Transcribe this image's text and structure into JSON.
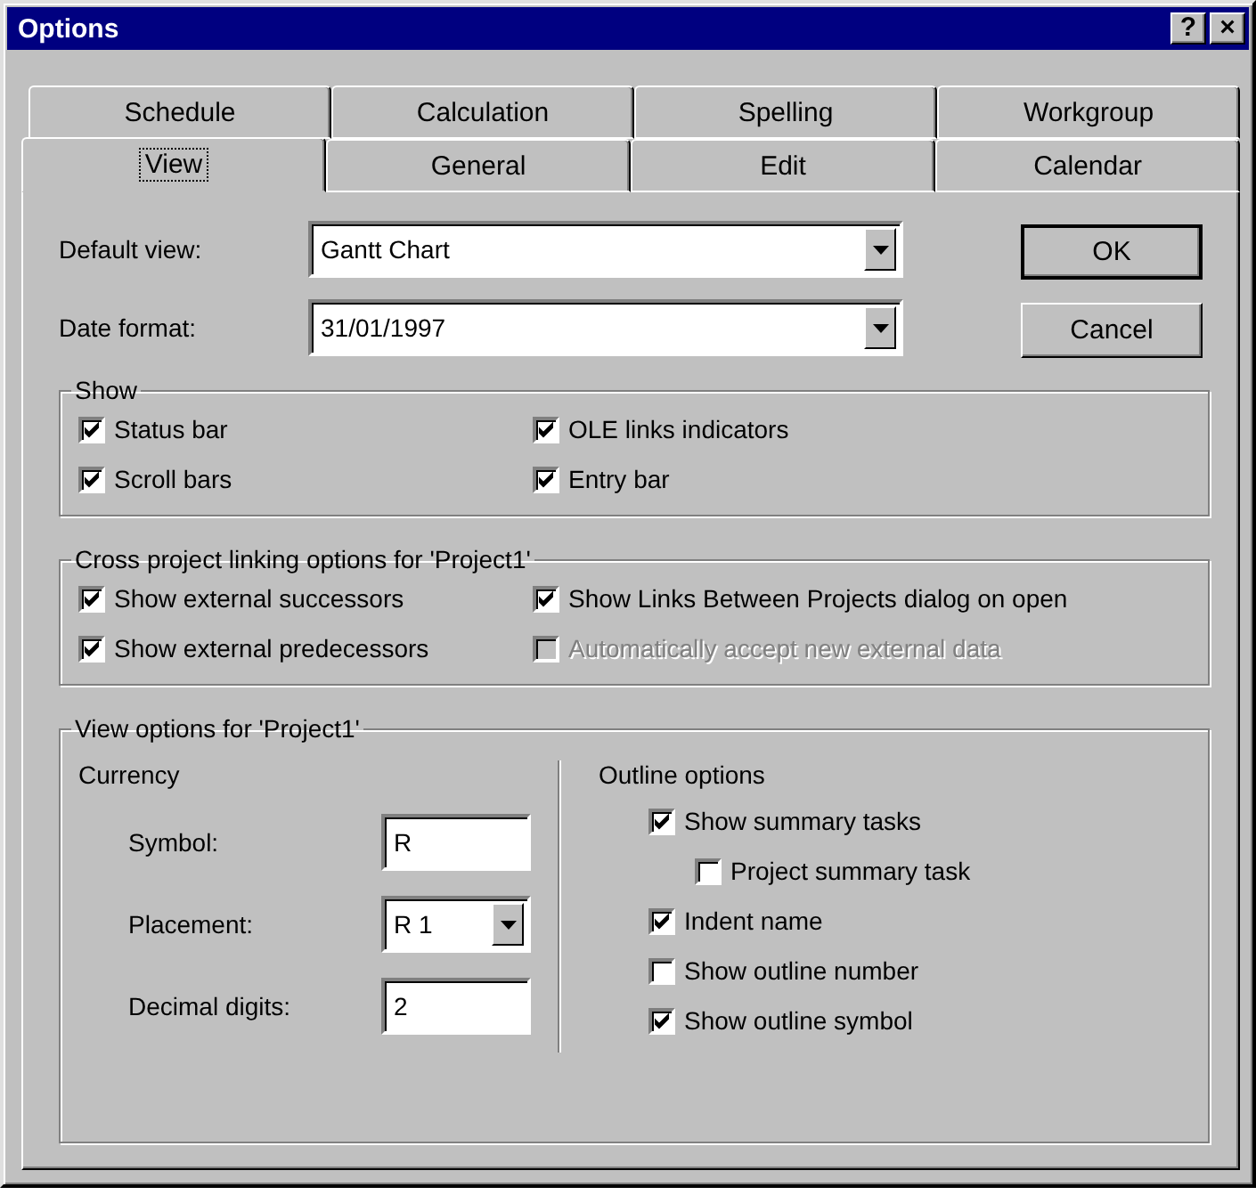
{
  "window": {
    "title": "Options",
    "help": "?",
    "close": "×"
  },
  "tab_rows": [
    {
      "tabs": [
        {
          "label": "Schedule",
          "selected": false
        },
        {
          "label": "Calculation",
          "selected": false
        },
        {
          "label": "Spelling",
          "selected": false
        },
        {
          "label": "Workgroup",
          "selected": false
        }
      ]
    },
    {
      "tabs": [
        {
          "label": "View",
          "selected": true
        },
        {
          "label": "General",
          "selected": false
        },
        {
          "label": "Edit",
          "selected": false
        },
        {
          "label": "Calendar",
          "selected": false
        }
      ]
    }
  ],
  "fields": [
    {
      "label": "Default view:",
      "value": "Gantt Chart"
    },
    {
      "label": "Date format:",
      "value": "31/01/1997"
    }
  ],
  "buttons": [
    {
      "label": "OK",
      "default": true
    },
    {
      "label": "Cancel",
      "default": false
    }
  ],
  "show": {
    "title": "Show",
    "items": [
      {
        "label": "Status bar",
        "checked": true
      },
      {
        "label": "OLE links indicators",
        "checked": true
      },
      {
        "label": "Scroll bars",
        "checked": true
      },
      {
        "label": "Entry bar",
        "checked": true
      }
    ]
  },
  "cross_project": {
    "title": "Cross project linking options for 'Project1'",
    "items": [
      {
        "label": "Show external successors",
        "checked": true,
        "disabled": false
      },
      {
        "label": "Show Links Between Projects dialog on open",
        "checked": true,
        "disabled": false
      },
      {
        "label": "Show external predecessors",
        "checked": true,
        "disabled": false
      },
      {
        "label": "Automatically accept new external data",
        "checked": false,
        "disabled": true
      }
    ]
  },
  "view_options": {
    "title": "View options for 'Project1'",
    "currency": {
      "title": "Currency",
      "fields": [
        {
          "kind": "text",
          "label": "Symbol:",
          "value": "R"
        },
        {
          "kind": "dropdown",
          "label": "Placement:",
          "value": "R 1"
        },
        {
          "kind": "text",
          "label": "Decimal digits:",
          "value": "2"
        }
      ]
    },
    "outline": {
      "title": "Outline options",
      "items": [
        {
          "label": "Show summary tasks",
          "checked": true,
          "children": [
            {
              "label": "Project summary task",
              "checked": false
            }
          ]
        },
        {
          "label": "Indent name",
          "checked": true
        },
        {
          "label": "Show outline number",
          "checked": false
        },
        {
          "label": "Show outline symbol",
          "checked": true
        }
      ]
    }
  }
}
